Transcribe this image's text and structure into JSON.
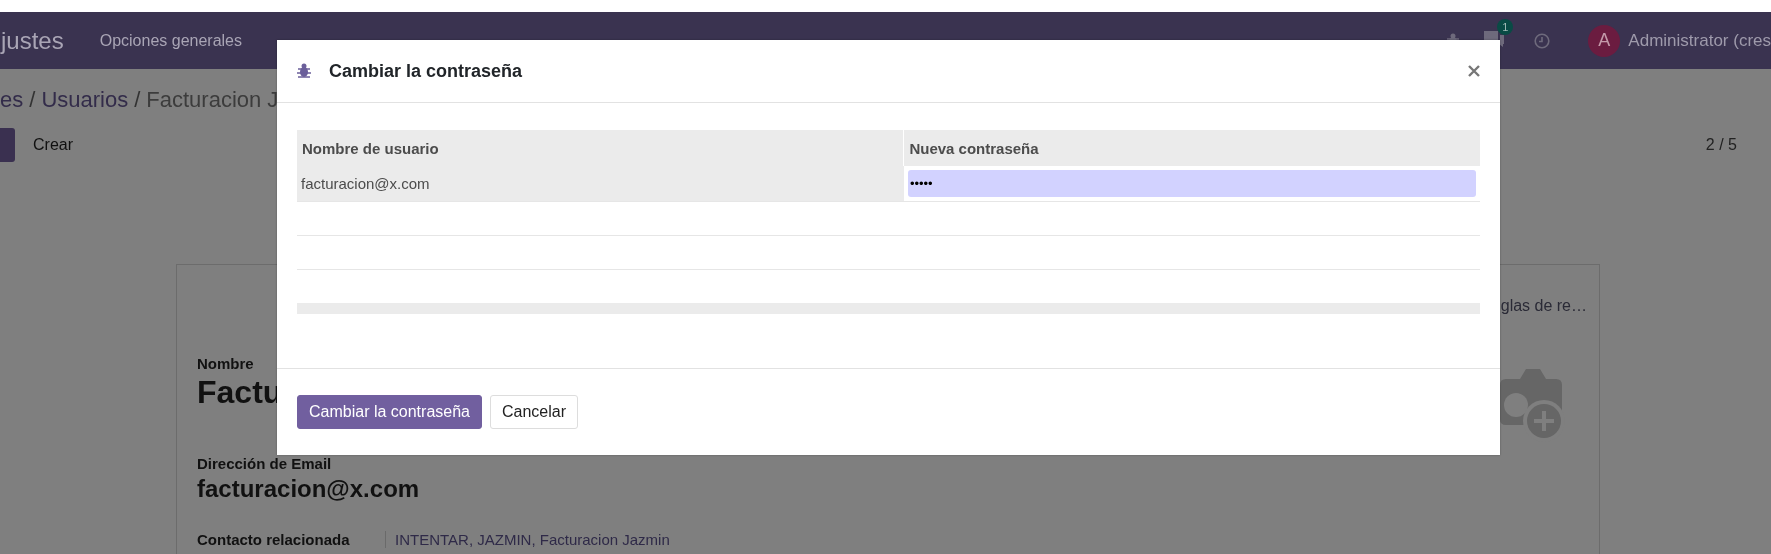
{
  "navbar": {
    "app_title": "justes",
    "menu": [
      {
        "label": "Opciones generales"
      }
    ],
    "messages_badge": "1",
    "avatar_letter": "A",
    "user": "Administrator (cres"
  },
  "breadcrumb": {
    "separator": "/",
    "items": [
      {
        "label": "es",
        "kind": "link"
      },
      {
        "label": "Usuarios",
        "kind": "link"
      },
      {
        "label": "Facturacion J",
        "kind": "current"
      }
    ]
  },
  "control_panel": {
    "create_button": "Crear",
    "pager": "2 / 5"
  },
  "form": {
    "smart_button": "glas de re…",
    "fields": [
      {
        "label": "Nombre",
        "value": "Factu",
        "kind": "title"
      },
      {
        "label": "Dirección de Email",
        "value": "facturacion@x.com",
        "kind": "heading"
      },
      {
        "label": "Contacto relacionada",
        "value": "INTENTAR, JAZMIN, Facturacion Jazmin",
        "kind": "inline"
      }
    ]
  },
  "dialog": {
    "title": "Cambiar la contraseña",
    "columns": [
      "Nombre de usuario",
      "Nueva contraseña"
    ],
    "rows": [
      {
        "user": "facturacion@x.com",
        "password": "•••••"
      }
    ],
    "buttons": [
      {
        "label": "Cambiar la contraseña",
        "kind": "primary"
      },
      {
        "label": "Cancelar",
        "kind": "secondary"
      }
    ]
  }
}
